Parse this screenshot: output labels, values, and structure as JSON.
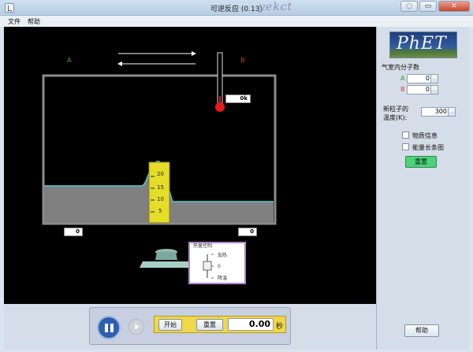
{
  "window": {
    "title": "可逆反应 (0.13)",
    "watermark": "yekct",
    "buttons": [
      "◌",
      "▭",
      "✕"
    ]
  },
  "menubar": {
    "file": "文件",
    "help": "帮助"
  },
  "sim": {
    "label_a": "A",
    "label_b": "B",
    "thermometer_readout": "0k",
    "count_left": "0",
    "count_right": "0",
    "ruler_ticks": [
      "20",
      "15",
      "10",
      "5"
    ]
  },
  "heat_control": {
    "title": "热量控制",
    "add": "加热",
    "zero": "0",
    "remove": "降温",
    "level": 0
  },
  "panel": {
    "logo": "PhET",
    "molecules_title": "气室内分子数",
    "a_label": "A",
    "a_value": "0",
    "b_label": "B",
    "b_value": "0",
    "temp_label_1": "新粒子的",
    "temp_label_2": "温度(K):",
    "temp_value": "300",
    "check_physics": "物质信息",
    "check_energy": "能量长条图",
    "reset": "重置",
    "help": "帮助"
  },
  "clock": {
    "start": "开始",
    "reset": "重置",
    "time": "0.00",
    "unit": "秒"
  },
  "colors": {
    "accent_green": "#4cd37a",
    "label_a": "#2fa02f",
    "label_b": "#e03a2f",
    "ruler": "#e6dc2a",
    "curve": "#57c7d6"
  }
}
